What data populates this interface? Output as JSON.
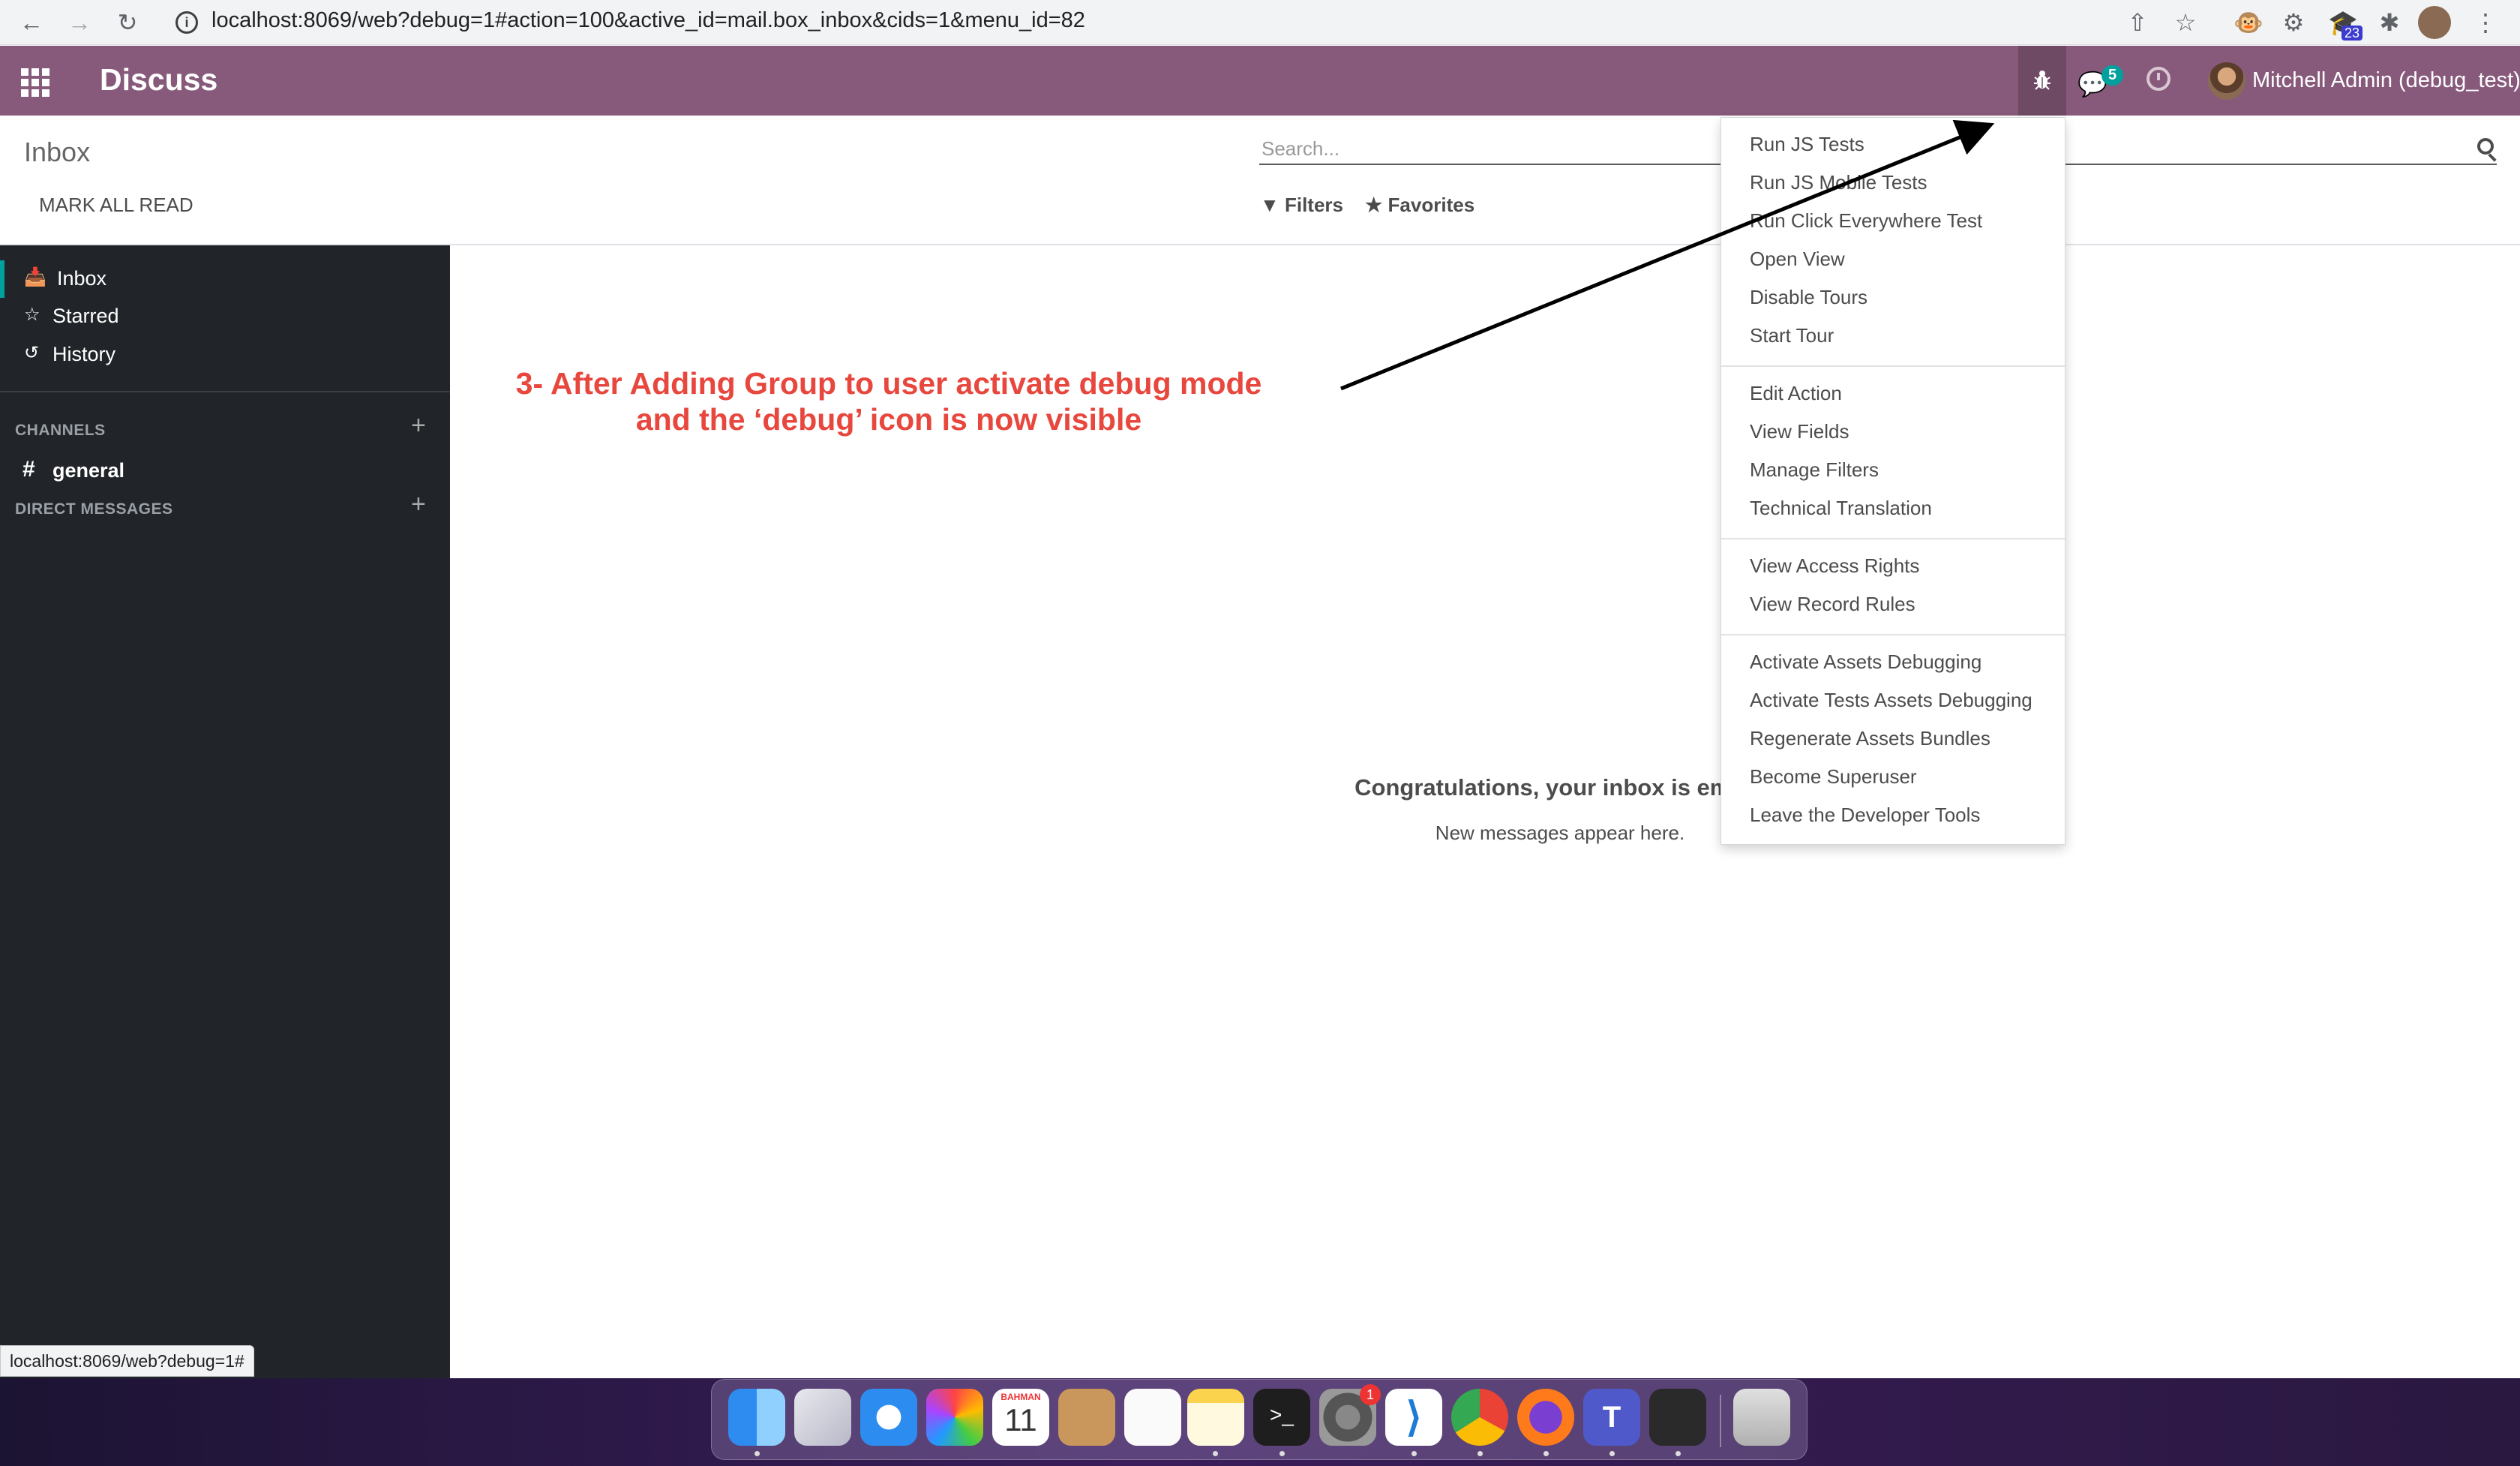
{
  "browser": {
    "url": "localhost:8069/web?debug=1#action=100&active_id=mail.box_inbox&cids=1&menu_id=82",
    "extension_badge": "23"
  },
  "navbar": {
    "app_title": "Discuss",
    "chat_count": "5",
    "user_name": "Mitchell Admin (debug_test)",
    "brand_color": "#875a7b"
  },
  "control_panel": {
    "title": "Inbox",
    "mark_all_read": "MARK ALL READ",
    "search_placeholder": "Search...",
    "filters": "Filters",
    "favorites": "Favorites"
  },
  "sidebar": {
    "items": [
      {
        "label": "Inbox",
        "icon": "inbox-icon"
      },
      {
        "label": "Starred",
        "icon": "star-icon"
      },
      {
        "label": "History",
        "icon": "history-icon"
      }
    ],
    "channels_header": "CHANNELS",
    "channels": [
      {
        "label": "general"
      }
    ],
    "direct_messages_header": "DIRECT MESSAGES"
  },
  "main": {
    "annotation_line1": "3- After Adding Group to user activate debug mode",
    "annotation_line2": "and the ‘debug’ icon is now visible",
    "empty_title": "Congratulations, your inbox is empty",
    "empty_subtitle": "New messages appear here."
  },
  "debug_menu": {
    "groups": [
      [
        "Run JS Tests",
        "Run JS Mobile Tests",
        "Run Click Everywhere Test",
        "Open View",
        "Disable Tours",
        "Start Tour"
      ],
      [
        "Edit Action",
        "View Fields",
        "Manage Filters",
        "Technical Translation"
      ],
      [
        "View Access Rights",
        "View Record Rules"
      ],
      [
        "Activate Assets Debugging",
        "Activate Tests Assets Debugging",
        "Regenerate Assets Bundles",
        "Become Superuser",
        "Leave the Developer Tools"
      ]
    ]
  },
  "status_bar": {
    "hover_url": "localhost:8069/web?debug=1#"
  },
  "dock": {
    "calendar_month": "BAHMAN",
    "calendar_day": "11",
    "settings_badge": "1"
  }
}
